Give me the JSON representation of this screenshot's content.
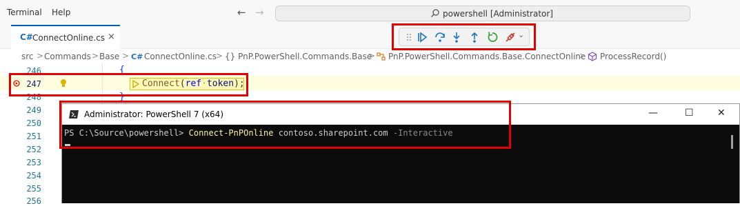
{
  "menu": {
    "terminal": "Terminal",
    "help": "Help"
  },
  "nav": {
    "back_icon": "arrow-left-icon",
    "forward_icon": "arrow-right-icon"
  },
  "command_center": {
    "text": "powershell [Administrator]",
    "icon": "search-icon"
  },
  "tab": {
    "icon_glyph": "C#",
    "label": "ConnectOnline.cs",
    "close_glyph": "×"
  },
  "debug_toolbar": {
    "grip": "grip-icon",
    "buttons": [
      "continue-icon",
      "step-over-icon",
      "step-into-icon",
      "step-out-icon",
      "restart-icon",
      "disconnect-icon"
    ],
    "dropdown_glyph": "⌄"
  },
  "breadcrumb": {
    "items": [
      "src",
      "Commands",
      "Base",
      "ConnectOnline.cs",
      "{} PnP.PowerShell.Commands.Base",
      "PnP.PowerShell.Commands.Base.ConnectOnline",
      "ProcessRecord()"
    ],
    "separator": ">"
  },
  "editor": {
    "line_numbers": [
      "246",
      "247",
      "248",
      "249",
      "250",
      "251",
      "252",
      "253",
      "254",
      "255",
      "256"
    ],
    "current_line": "247",
    "code_line_246": "{",
    "code_line_247": {
      "method": "Connect",
      "open": "(",
      "keyword": "ref",
      "arg": "token",
      "close": ");"
    },
    "code_line_248": "}",
    "highlight_color": "#fffde0"
  },
  "terminal": {
    "title": "Administrator: PowerShell 7 (x64)",
    "prompt": "PS C:\\Source\\powershell>",
    "command": "Connect-PnPOnline",
    "argument": "contoso.sharepoint.com",
    "parameter": "-Interactive",
    "controls": {
      "minimize": "—",
      "maximize": "☐",
      "close": "✕"
    }
  },
  "colors": {
    "accent": "#005fb8",
    "annotation": "#e00000",
    "terminal_bg": "#0c0c0c",
    "command_yellow": "#f9f1a5"
  }
}
